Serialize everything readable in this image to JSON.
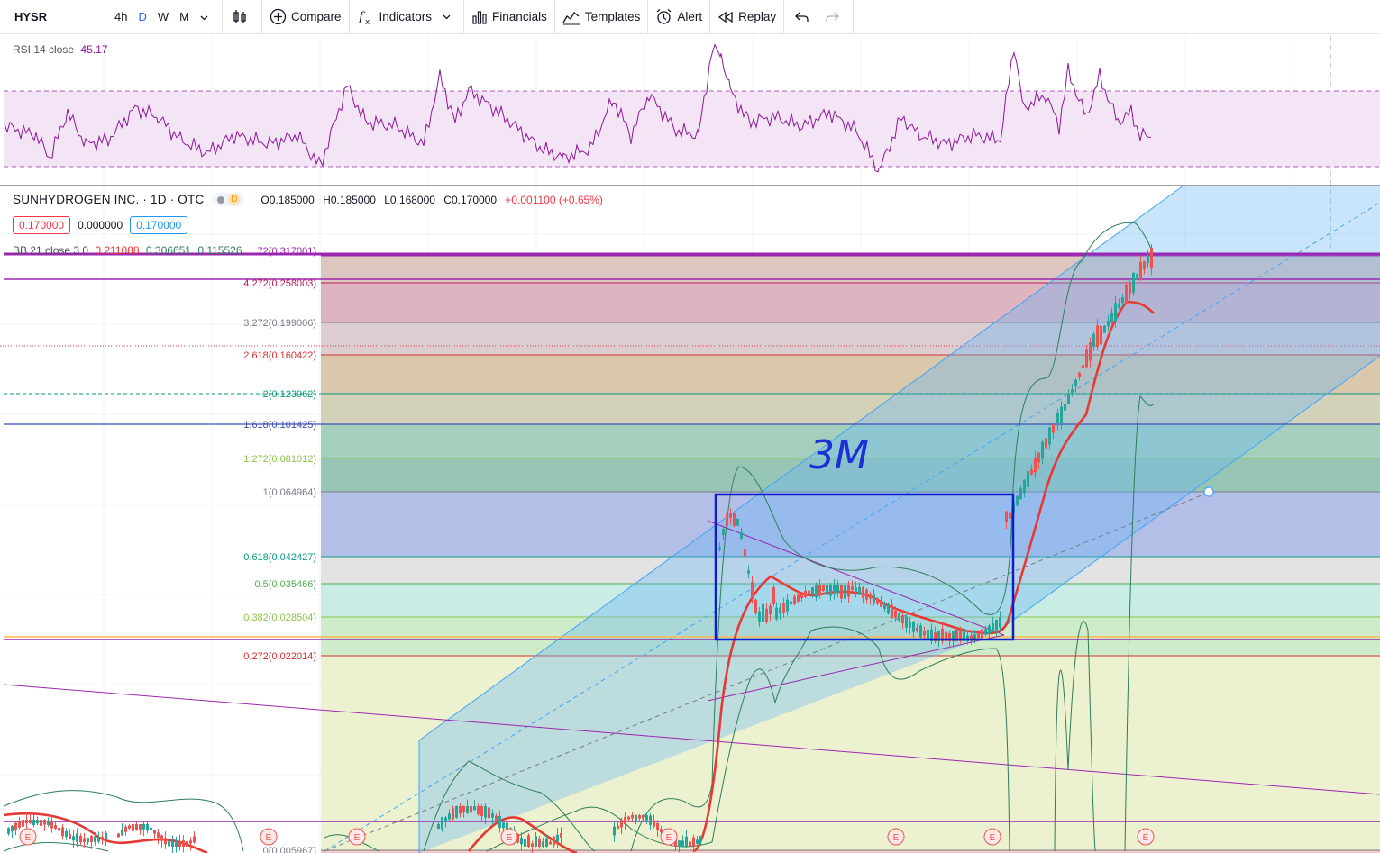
{
  "toolbar": {
    "symbol": "HYSR",
    "intervals": [
      "4h",
      "D",
      "W",
      "M"
    ],
    "active_interval": "D",
    "compare": "Compare",
    "indicators": "Indicators",
    "financials": "Financials",
    "templates": "Templates",
    "alert": "Alert",
    "replay": "Replay"
  },
  "rsi": {
    "label": "RSI 14 close",
    "value": "45.17",
    "color": "#8e1599",
    "band_color": "#f3e5f5"
  },
  "legend": {
    "symbol": "SUNHYDROGEN INC. · 1D · OTC",
    "source_badge": "D",
    "o": "O0.185000",
    "h": "H0.185000",
    "l": "L0.168000",
    "c": "C0.170000",
    "change": "+0.001100 (+0.65%)",
    "price_left": "0.170000",
    "price_mid": "0.000000",
    "price_right": "0.170000",
    "bb_label": "BB 21 close 3 0",
    "bb_basis": "0.211088",
    "bb_upper": "0.306651",
    "bb_lower": "0.115526"
  },
  "annotation": "3M",
  "earnings_marker": "E",
  "colors": {
    "candle_up": "#26a69a",
    "candle_down": "#ef5350",
    "bb_basis": "#e53935",
    "bb_bands": "#2e7d5b",
    "channel": "#42a5f5",
    "box": "#0d1dc9",
    "annotation": "#1a2fd6"
  },
  "fib_levels": [
    {
      "label": "4.272(0.258003)",
      "color": "#c2185b",
      "fill": "#ddb4c0"
    },
    {
      "label": "3.272(0.199006)",
      "color": "#787b86",
      "fill": "#dccdd0"
    },
    {
      "label": "2.618(0.160422)",
      "color": "#d32f2f",
      "fill": "#d9c8ab"
    },
    {
      "label": "2(0.123962)",
      "color": "#089981",
      "fill": "#d3d2b8"
    },
    {
      "label": "1.618(0.101425)",
      "color": "#3f51b5",
      "fill": "#a5cfbd"
    },
    {
      "label": "1.272(0.081012)",
      "color": "#8bc34a",
      "fill": "#97c6b6"
    },
    {
      "label": "1(0.064964)",
      "color": "#787b86",
      "fill": "#b4bfe8"
    },
    {
      "label": "0.618(0.042427)",
      "color": "#089981",
      "fill": "#e3e3e3"
    },
    {
      "label": "0.5(0.035466)",
      "color": "#4caf50",
      "fill": "#c9ece5"
    },
    {
      "label": "0.382(0.028504)",
      "color": "#8bc34a",
      "fill": "#cfecca"
    },
    {
      "label": "0.272(0.022014)",
      "color": "#d32f2f",
      "fill": "#ecf2cf"
    },
    {
      "label": "0(0.005967)",
      "color": "#787b86",
      "fill": "#f3c7c7"
    }
  ],
  "top_fib_label": "72(0.317001)",
  "chart_data": {
    "type": "candlestick",
    "title": "SUNHYDROGEN INC. · 1D · OTC",
    "close_last": 0.17,
    "rsi_last": 45.17,
    "fib_retracement": [
      {
        "ratio": 4.272,
        "price": 0.258003
      },
      {
        "ratio": 3.272,
        "price": 0.199006
      },
      {
        "ratio": 2.618,
        "price": 0.160422
      },
      {
        "ratio": 2,
        "price": 0.123962
      },
      {
        "ratio": 1.618,
        "price": 0.101425
      },
      {
        "ratio": 1.272,
        "price": 0.081012
      },
      {
        "ratio": 1,
        "price": 0.064964
      },
      {
        "ratio": 0.618,
        "price": 0.042427
      },
      {
        "ratio": 0.5,
        "price": 0.035466
      },
      {
        "ratio": 0.382,
        "price": 0.028504
      },
      {
        "ratio": 0.272,
        "price": 0.022014
      },
      {
        "ratio": 0,
        "price": 0.005967
      }
    ],
    "bollinger": {
      "length": 21,
      "mult": 3,
      "basis": 0.211088,
      "upper": 0.306651,
      "lower": 0.115526
    },
    "annotation": "3M"
  }
}
